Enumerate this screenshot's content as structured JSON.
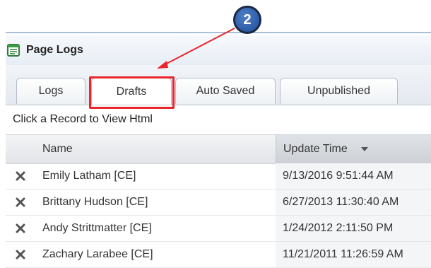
{
  "callout": {
    "number": "2"
  },
  "panel": {
    "title": "Page Logs"
  },
  "tabs": [
    {
      "label": "Logs",
      "active": false
    },
    {
      "label": "Drafts",
      "active": true
    },
    {
      "label": "Auto Saved",
      "active": false
    },
    {
      "label": "Unpublished",
      "active": false
    }
  ],
  "caption": "Click a Record to View Html",
  "grid": {
    "columns": {
      "name": "Name",
      "update_time": "Update Time"
    },
    "sort_icon": "sort-descending-icon",
    "rows": [
      {
        "name": "Emily Latham [CE]",
        "update_time": "9/13/2016 9:51:44 AM"
      },
      {
        "name": "Brittany Hudson [CE]",
        "update_time": "6/27/2013 11:30:40 AM"
      },
      {
        "name": "Andy Strittmatter [CE]",
        "update_time": "1/24/2012 2:11:50 PM"
      },
      {
        "name": "Zachary Larabee [CE]",
        "update_time": "11/21/2011 11:26:59 AM"
      }
    ]
  },
  "colors": {
    "highlight": "#e8262c",
    "callout": "#2d5aa8"
  }
}
